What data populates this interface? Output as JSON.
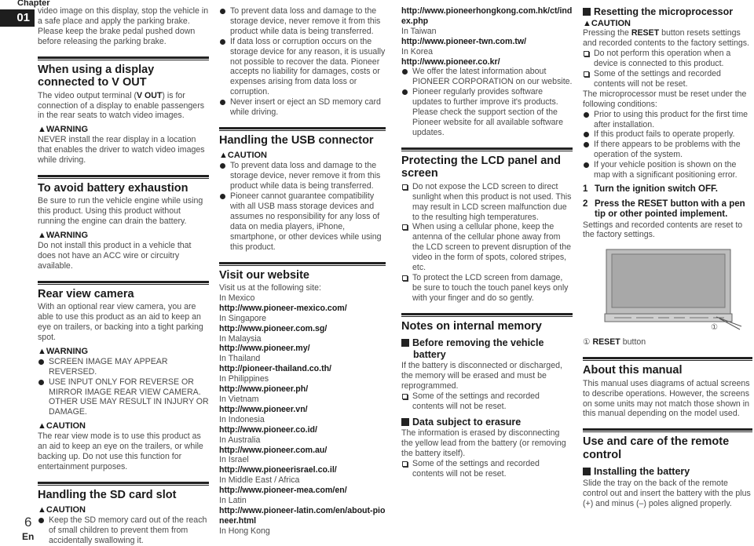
{
  "page": {
    "chapter_label": "Chapter",
    "chapter_number": "01",
    "page_number": "6",
    "language": "En"
  },
  "col1": {
    "intro": "video image on this display, stop the vehicle in a safe place and apply the parking brake. Please keep the brake pedal pushed down before releasing the parking brake.",
    "vout": {
      "heading": "When using a display connected to V OUT",
      "body_pre": "The video output terminal (",
      "body_bold": "V OUT",
      "body_post": ") is for connection of a display to enable passengers in the rear seats to watch video images.",
      "warning_label": "WARNING",
      "warning_text": "NEVER install the rear display in a location that enables the driver to watch video images while driving."
    },
    "battery": {
      "heading": "To avoid battery exhaustion",
      "body": "Be sure to run the vehicle engine while using this product. Using this product without running the engine can drain the battery.",
      "warning_label": "WARNING",
      "warning_text": "Do not install this product in a vehicle that does not have an ACC wire or circuitry available."
    },
    "camera": {
      "heading": "Rear view camera",
      "body": "With an optional rear view camera, you are able to use this product as an aid to keep an eye on trailers, or backing into a tight parking spot.",
      "warning_label": "WARNING",
      "warning_items": [
        "SCREEN IMAGE MAY APPEAR REVERSED.",
        "USE INPUT ONLY FOR REVERSE OR MIRROR IMAGE REAR VIEW CAMERA. OTHER USE MAY RESULT IN INJURY OR DAMAGE."
      ],
      "caution_label": "CAUTION",
      "caution_text": "The rear view mode is to use this product as an aid to keep an eye on the trailers, or while backing up. Do not use this function for entertainment purposes."
    },
    "sd": {
      "heading": "Handling the SD card slot",
      "caution_label": "CAUTION",
      "items": [
        "Keep the SD memory card out of the reach of small children to prevent them from accidentally swallowing it."
      ]
    }
  },
  "col2": {
    "sd_items": [
      "To prevent data loss and damage to the storage device, never remove it from this product while data is being transferred.",
      "If data loss or corruption occurs on the storage device for any reason, it is usually not possible to recover the data. Pioneer accepts no liability for damages, costs or expenses arising from data loss or corruption.",
      "Never insert or eject an SD memory card while driving."
    ],
    "usb": {
      "heading": "Handling the USB connector",
      "caution_label": "CAUTION",
      "items": [
        "To prevent data loss and damage to the storage device, never remove it from this product while data is being transferred.",
        "Pioneer cannot guarantee compatibility with all USB mass storage devices and assumes no responsibility for any loss of data on media players, iPhone, smartphone, or other devices while using this product."
      ]
    },
    "website": {
      "heading": "Visit our website",
      "intro": "Visit us at the following site:",
      "sites": [
        {
          "region": "In Mexico",
          "url": "http://www.pioneer-mexico.com/"
        },
        {
          "region": "In Singapore",
          "url": "http://www.pioneer.com.sg/"
        },
        {
          "region": "In Malaysia",
          "url": "http://www.pioneer.my/"
        },
        {
          "region": "In Thailand",
          "url": "http://pioneer-thailand.co.th/"
        },
        {
          "region": "In Philippines",
          "url": "http://www.pioneer.ph/"
        },
        {
          "region": "In Vietnam",
          "url": "http://www.pioneer.vn/"
        },
        {
          "region": "In Indonesia",
          "url": "http://www.pioneer.co.id/"
        },
        {
          "region": "In Australia",
          "url": "http://www.pioneer.com.au/"
        },
        {
          "region": "In Israel",
          "url": "http://www.pioneerisrael.co.il/"
        },
        {
          "region": "In Middle East / Africa",
          "url": "http://www.pioneer-mea.com/en/"
        },
        {
          "region": "In Latin",
          "url": "http://www.pioneer-latin.com/en/about-pioneer.html"
        }
      ],
      "last_region": "In Hong Kong"
    }
  },
  "col3": {
    "sites": [
      {
        "url": "http://www.pioneerhongkong.com.hk/ct/index.php"
      },
      {
        "region": "In Taiwan",
        "url": "http://www.pioneer-twn.com.tw/"
      },
      {
        "region": "In Korea",
        "url": "http://www.pioneer.co.kr/"
      }
    ],
    "items": [
      "We offer the latest information about PIONEER CORPORATION on our website.",
      "Pioneer regularly provides software updates to further improve it's products. Please check the support section of the Pioneer website for all available software updates."
    ],
    "lcd": {
      "heading": "Protecting the LCD panel and screen",
      "items": [
        "Do not expose the LCD screen to direct sunlight when this product is not used. This may result in LCD screen malfunction due to the resulting high temperatures.",
        "When using a cellular phone, keep the antenna of the cellular phone away from the LCD screen to prevent disruption of the video in the form of spots, colored stripes, etc.",
        "To protect the LCD screen from damage, be sure to touch the touch panel keys only with your finger and do so gently."
      ]
    },
    "memory": {
      "heading": "Notes on internal memory",
      "sub1": "Before removing the vehicle battery",
      "sub1_body": "If the battery is disconnected or discharged, the memory will be erased and must be reprogrammed.",
      "sub1_items": [
        "Some of the settings and recorded contents will not be reset."
      ],
      "sub2": "Data subject to erasure",
      "sub2_body": "The information is erased by disconnecting the yellow lead from the battery (or removing the battery itself).",
      "sub2_items": [
        "Some of the settings and recorded contents will not be reset."
      ]
    }
  },
  "col4": {
    "reset": {
      "heading": "Resetting the microprocessor",
      "caution_label": "CAUTION",
      "body_pre": "Pressing the ",
      "body_bold": "RESET",
      "body_post": " button resets settings and recorded contents to the factory settings.",
      "notes": [
        "Do not perform this operation when a device is connected to this product.",
        "Some of the settings and recorded contents will not be reset."
      ],
      "conditions_intro": "The microprocessor must be reset under the following conditions:",
      "conditions": [
        "Prior to using this product for the first time after installation.",
        "If this product fails to operate properly.",
        "If there appears to be problems with the operation of the system.",
        "If your vehicle position is shown on the map with a significant positioning error."
      ],
      "steps": [
        {
          "n": "1",
          "text": "Turn the ignition switch OFF."
        },
        {
          "n": "2",
          "text": "Press the RESET button with a pen tip or other pointed implement."
        }
      ],
      "result": "Settings and recorded contents are reset to the factory settings.",
      "callout": "①",
      "caption_num": "①",
      "caption_bold": "RESET",
      "caption_rest": " button"
    },
    "manual": {
      "heading": "About this manual",
      "body": "This manual uses diagrams of actual screens to describe operations. However, the screens on some units may not match those shown in this manual depending on the model used."
    },
    "remote": {
      "heading": "Use and care of the remote control",
      "sub": "Installing the battery",
      "body": "Slide the tray on the back of the remote control out and insert the battery with the plus (+) and minus (–) poles aligned properly."
    }
  }
}
